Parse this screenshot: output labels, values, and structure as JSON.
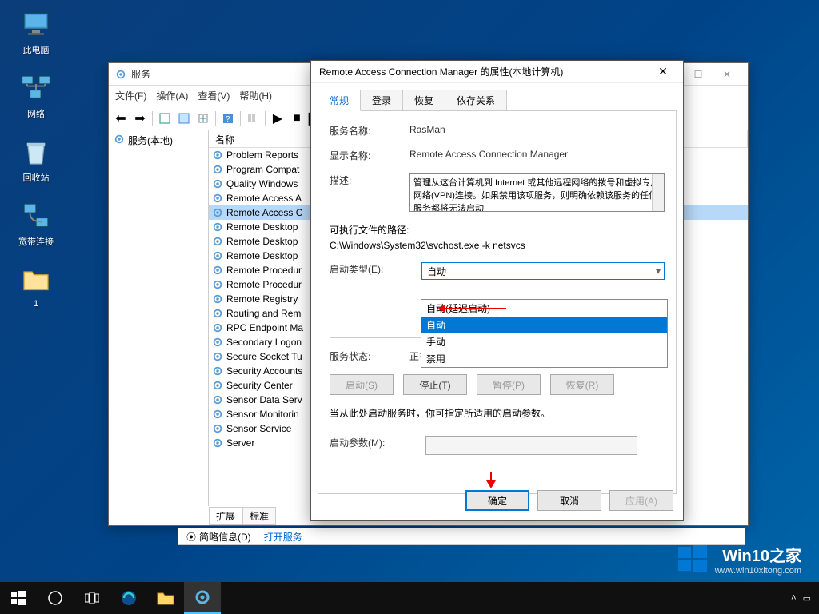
{
  "desktop": {
    "icons": [
      "此电脑",
      "网络",
      "回收站",
      "宽带连接",
      "1"
    ]
  },
  "services_window": {
    "title": "服务",
    "menu": [
      "文件(F)",
      "操作(A)",
      "查看(V)",
      "帮助(H)"
    ],
    "left_panel_item": "服务(本地)",
    "column_name": "名称",
    "services": [
      "Problem Reports",
      "Program Compat",
      "Quality Windows",
      "Remote Access A",
      "Remote Access C",
      "Remote Desktop",
      "Remote Desktop",
      "Remote Desktop",
      "Remote Procedur",
      "Remote Procedur",
      "Remote Registry",
      "Routing and Rem",
      "RPC Endpoint Ma",
      "Secondary Logon",
      "Secure Socket Tu",
      "Security Accounts",
      "Security Center",
      "Sensor Data Serv",
      "Sensor Monitorin",
      "Sensor Service",
      "Server"
    ],
    "selected_index": 4,
    "bottom_tabs": [
      "扩展",
      "标准"
    ]
  },
  "properties_dialog": {
    "title": "Remote Access Connection Manager 的属性(本地计算机)",
    "tabs": [
      "常规",
      "登录",
      "恢复",
      "依存关系"
    ],
    "fields": {
      "service_name_label": "服务名称:",
      "service_name": "RasMan",
      "display_name_label": "显示名称:",
      "display_name": "Remote Access Connection Manager",
      "description_label": "描述:",
      "description": "管理从这台计算机到 Internet 或其他远程网络的拨号和虚拟专用网络(VPN)连接。如果禁用该项服务，则明确依赖该服务的任何服务都将无法启动",
      "exe_path_label": "可执行文件的路径:",
      "exe_path": "C:\\Windows\\System32\\svchost.exe -k netsvcs",
      "startup_type_label": "启动类型(E):",
      "startup_type_value": "自动",
      "service_status_label": "服务状态:",
      "service_status": "正在运行",
      "startup_params_label": "启动参数(M):"
    },
    "dropdown_options": [
      "自动(延迟启动)",
      "自动",
      "手动",
      "禁用"
    ],
    "dropdown_highlighted": 1,
    "action_buttons": [
      "启动(S)",
      "停止(T)",
      "暂停(P)",
      "恢复(R)"
    ],
    "hint_text": "当从此处启动服务时，你可指定所适用的启动参数。",
    "dialog_buttons": {
      "ok": "确定",
      "cancel": "取消",
      "apply": "应用(A)"
    }
  },
  "misc_strip": {
    "item1": "简略信息(D)",
    "item2": "打开服务"
  },
  "watermark": {
    "brand": "Win10之家",
    "url": "www.win10xitong.com"
  }
}
